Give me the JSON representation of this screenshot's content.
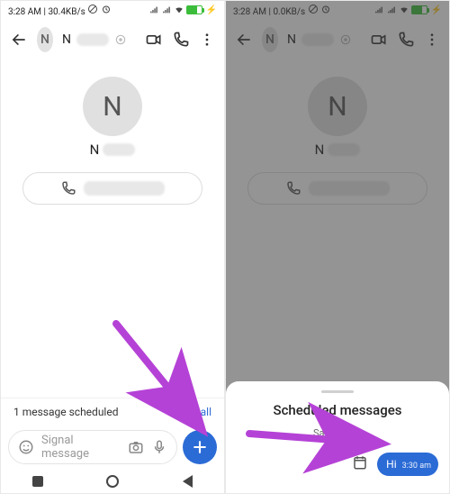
{
  "status": {
    "time": "3:28 AM",
    "net_left": "30.4KB/s",
    "net_right": "0.0KB/s"
  },
  "contact": {
    "initial": "N",
    "name_letter": "N"
  },
  "banner": {
    "text": "1 message scheduled",
    "link": "See all"
  },
  "composer": {
    "placeholder": "Signal message"
  },
  "sheet": {
    "title": "Scheduled messages",
    "date": "Sat, 24 Feb",
    "bubble_text": "Hi",
    "bubble_time": "3:30 am"
  },
  "colors": {
    "accent": "#2b6bd6",
    "arrow": "#b542d6"
  }
}
